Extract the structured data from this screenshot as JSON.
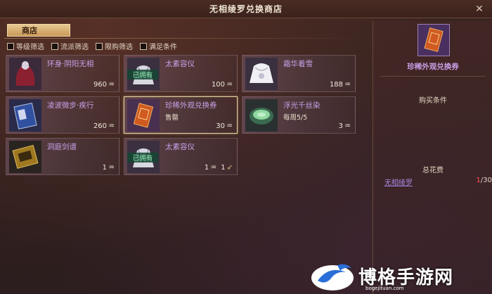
{
  "window": {
    "title": "无相绫罗兑换商店",
    "close_symbol": "✕"
  },
  "shop_tab": {
    "label": "商店"
  },
  "filters": [
    {
      "label": "等级筛选"
    },
    {
      "label": "流派筛选"
    },
    {
      "label": "限购筛选"
    },
    {
      "label": "满足条件"
    }
  ],
  "items": [
    {
      "name": "环身·阴阳无相",
      "sub": "",
      "price": "960",
      "owned_tag": "",
      "icon": "robe-icon"
    },
    {
      "name": "太素容仪",
      "sub": "",
      "price": "100",
      "owned_tag": "已拥有",
      "icon": "outfit-icon"
    },
    {
      "name": "霜华着雪",
      "sub": "",
      "price": "188",
      "owned_tag": "",
      "icon": "white-outfit-icon"
    },
    {
      "name": "凌波微步·疾行",
      "sub": "",
      "price": "260",
      "owned_tag": "",
      "icon": "book-icon"
    },
    {
      "name": "珍稀外观兑换券",
      "sub": "售罄",
      "price": "30",
      "owned_tag": "",
      "icon": "voucher-icon"
    },
    {
      "name": "浮光千丝染",
      "sub": "每周5/5",
      "price": "3",
      "owned_tag": "",
      "icon": "dye-bowl-icon"
    },
    {
      "name": "洞庭剑谱",
      "sub": "",
      "price": "1",
      "owned_tag": "",
      "icon": "scroll-box-icon"
    },
    {
      "name": "太素容仪",
      "sub": "",
      "price": "1",
      "price2": "1",
      "owned_tag": "已拥有",
      "icon": "outfit-icon"
    }
  ],
  "detail": {
    "name": "珍稀外观兑换券",
    "purchase_condition_label": "购买条件",
    "total_cost_label": "总花费",
    "cost_item_name": "无相绫罗",
    "cost_have": "1",
    "cost_need": "/30"
  },
  "watermark": {
    "text": "博格手游网",
    "sub": "bogejituan.com"
  },
  "colors": {
    "item_name": "#c8a0e8",
    "owned_tag": "#8ee8b0",
    "shop_tab": "#e8c890",
    "insufficient": "#ff5050"
  }
}
